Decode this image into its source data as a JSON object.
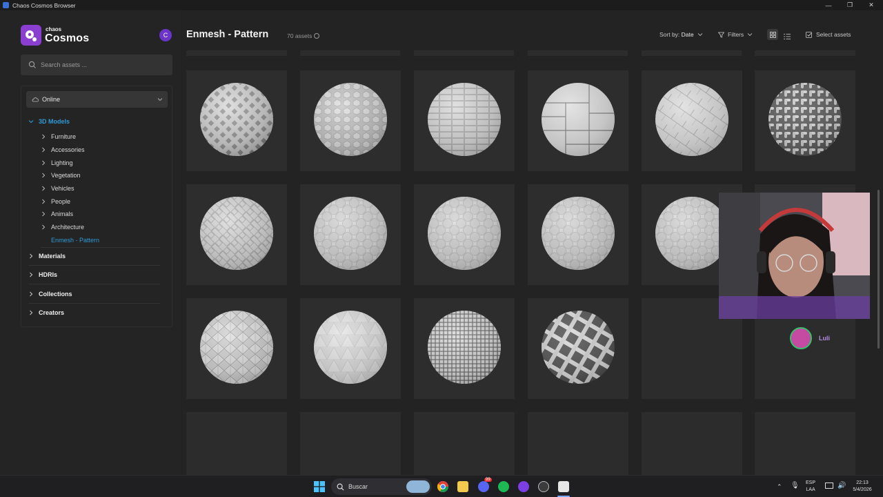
{
  "window": {
    "title": "Chaos Cosmos Browser",
    "minimize": "—",
    "maximize": "❐",
    "close": "✕"
  },
  "brand": {
    "small": "chaos",
    "big": "Cosmos",
    "avatar_letter": "C",
    "color": "#8b3fd1"
  },
  "search": {
    "placeholder": "Search assets ..."
  },
  "source": {
    "label": "Online"
  },
  "tree": {
    "section_3d": "3D Models",
    "children": [
      "Furniture",
      "Accessories",
      "Lighting",
      "Vegetation",
      "Vehicles",
      "People",
      "Animals",
      "Architecture"
    ],
    "active_child": "Enmesh - Pattern",
    "sections": [
      "Materials",
      "HDRIs",
      "Collections",
      "Creators"
    ],
    "active_color": "#2f9ad8"
  },
  "header": {
    "title": "Enmesh - Pattern",
    "count": "70 assets",
    "sort_label": "Sort by:",
    "sort_value": "Date",
    "filters": "Filters",
    "select_assets": "Select assets"
  },
  "assets": [
    {
      "pattern": "diamond-grid"
    },
    {
      "pattern": "hex-bubbles"
    },
    {
      "pattern": "brick-tiles"
    },
    {
      "pattern": "parquet-planks"
    },
    {
      "pattern": "herringbone"
    },
    {
      "pattern": "woven-rope"
    },
    {
      "pattern": "basket-weave"
    },
    {
      "pattern": "quilted"
    },
    {
      "pattern": "quilted"
    },
    {
      "pattern": "quilted"
    },
    {
      "pattern": "quilted"
    },
    {
      "pattern": "empty"
    },
    {
      "pattern": "star-facets"
    },
    {
      "pattern": "triangle-facets"
    },
    {
      "pattern": "fine-grid"
    },
    {
      "pattern": "lattice"
    },
    {
      "pattern": "empty"
    },
    {
      "pattern": "empty"
    }
  ],
  "overlay": {
    "streamer_name": "Luli"
  },
  "taskbar": {
    "search_label": "Buscar",
    "lang_top": "ESP",
    "lang_bottom": "LAA",
    "time": "22:13",
    "date": "5/4/2026",
    "discord_badge": "99"
  }
}
